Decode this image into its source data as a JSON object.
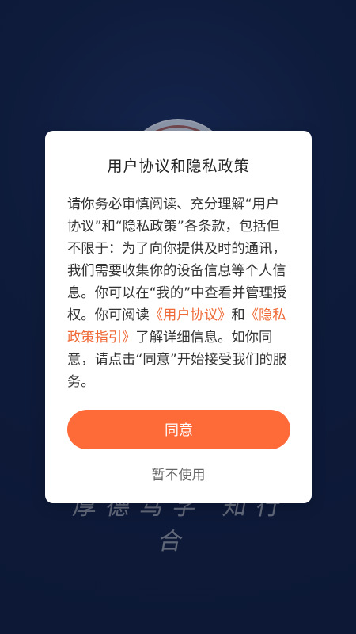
{
  "background": {
    "color": "#13234b",
    "emblem_icon": "school-emblem-icon"
  },
  "dialog": {
    "title": "用户协议和隐私政策",
    "body_part_1": "请你务必审慎阅读、充分理解“用户协议”和“隐私政策”各条款，包括但不限于：为了向你提供及时的通讯，我们需要收集你的设备信息等个人信息。你可以在“我的”中查看并管理授权。你可阅读",
    "user_agreement_link": "《用户协议》",
    "body_part_2": "和",
    "privacy_link": "《隐私政策指引》",
    "body_part_3": "了解详细信息。如你同意，请点击“同意”开始接受我们的服务。",
    "agree_label": "同意",
    "reject_label": "暂不使用",
    "accent_color": "#fe6a38",
    "link_color": "#ef6a36"
  }
}
